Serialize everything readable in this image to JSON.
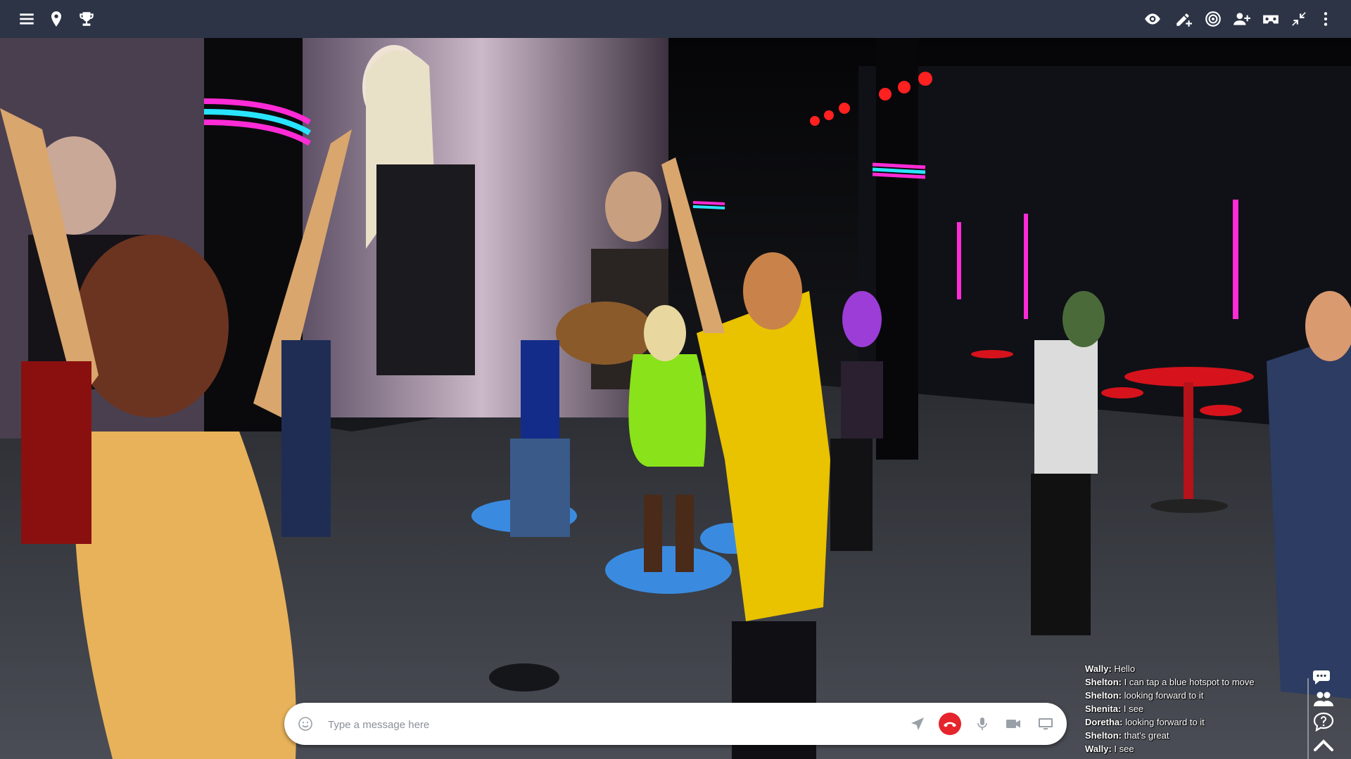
{
  "topbar": {
    "left_icons": [
      "menu-icon",
      "map-pin-icon",
      "trophy-icon"
    ],
    "right_icons": [
      "eye-icon",
      "edit-add-icon",
      "target-icon",
      "add-user-icon",
      "vr-headset-icon",
      "collapse-icon",
      "more-vertical-icon"
    ]
  },
  "chat": {
    "messages": [
      {
        "user": "Wally:",
        "text": " Hello"
      },
      {
        "user": "Shelton:",
        "text": " I can tap a blue hotspot to move"
      },
      {
        "user": "Shelton:",
        "text": " looking forward to it"
      },
      {
        "user": "Shenita:",
        "text": " I see"
      },
      {
        "user": "Doretha:",
        "text": " looking forward to it"
      },
      {
        "user": "Shelton:",
        "text": " that's great"
      },
      {
        "user": "Wally:",
        "text": " I see"
      }
    ]
  },
  "side_buttons": [
    "chat-bubbles-icon",
    "people-icon",
    "help-icon",
    "chevron-up-icon"
  ],
  "message_bar": {
    "placeholder": "Type a message here",
    "icons": [
      "emoji-icon",
      "send-icon",
      "hangup-icon",
      "microphone-icon",
      "camera-icon",
      "screen-share-icon"
    ]
  },
  "colors": {
    "topbar_bg": "#2c3446",
    "hangup": "#e5242b",
    "hotspot": "#3a8be0",
    "neon_pink": "#ff2bd6",
    "neon_cyan": "#29e4ff"
  }
}
